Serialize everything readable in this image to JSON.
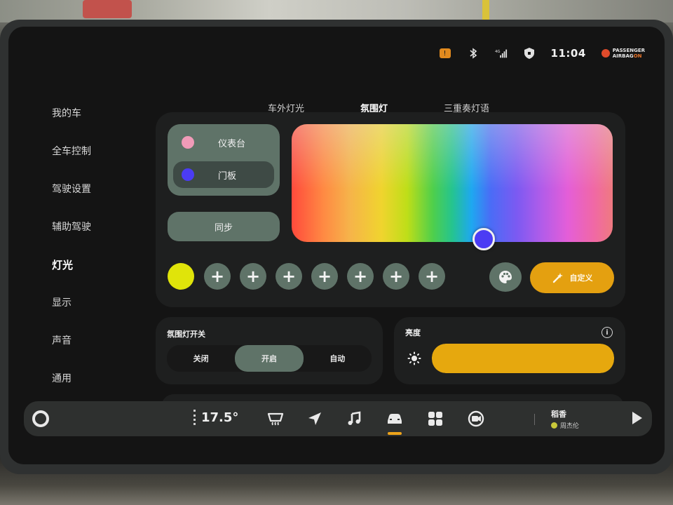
{
  "status_bar": {
    "time": "11:04",
    "airbag_line1": "PASSENGER",
    "airbag_line2": "AIRBAG",
    "airbag_state": "ON",
    "network": "4G",
    "icons": [
      "warning-icon",
      "bluetooth-icon",
      "signal-icon",
      "shield-icon"
    ]
  },
  "sidebar": {
    "items": [
      {
        "label": "我的车",
        "active": false
      },
      {
        "label": "全车控制",
        "active": false
      },
      {
        "label": "驾驶设置",
        "active": false
      },
      {
        "label": "辅助驾驶",
        "active": false
      },
      {
        "label": "灯光",
        "active": true
      },
      {
        "label": "显示",
        "active": false
      },
      {
        "label": "声音",
        "active": false
      },
      {
        "label": "通用",
        "active": false
      }
    ]
  },
  "tabs": [
    {
      "label": "车外灯光",
      "active": false
    },
    {
      "label": "氛围灯",
      "active": true
    },
    {
      "label": "三重奏灯语",
      "active": false
    }
  ],
  "zones": [
    {
      "label": "仪表台",
      "color": "#f09bb8"
    },
    {
      "label": "门板",
      "color": "#4b3cf4",
      "selected": true
    }
  ],
  "sync_label": "同步",
  "picker_color": "#4b3cf4",
  "presets": {
    "active_color": "#e0e40a",
    "add_symbol": "+",
    "add_count": 7
  },
  "custom_label": "自定义",
  "ambient_switch": {
    "title": "氛围灯开关",
    "options": [
      {
        "label": "关闭",
        "active": false
      },
      {
        "label": "开启",
        "active": true
      },
      {
        "label": "自动",
        "active": false
      }
    ]
  },
  "brightness": {
    "title": "亮度",
    "info_symbol": "i",
    "level": 1.0
  },
  "dock": {
    "temperature": "17.5°",
    "track_title": "稻香",
    "track_artist": "周杰伦",
    "apps": [
      "defrost-icon",
      "navigation-icon",
      "music-icon",
      "car-icon",
      "apps-grid-icon",
      "camera-icon"
    ],
    "active_app": "car-icon"
  },
  "colors": {
    "accent": "#eda31a",
    "panel": "#1e1f1f",
    "sage": "#5f7368"
  }
}
